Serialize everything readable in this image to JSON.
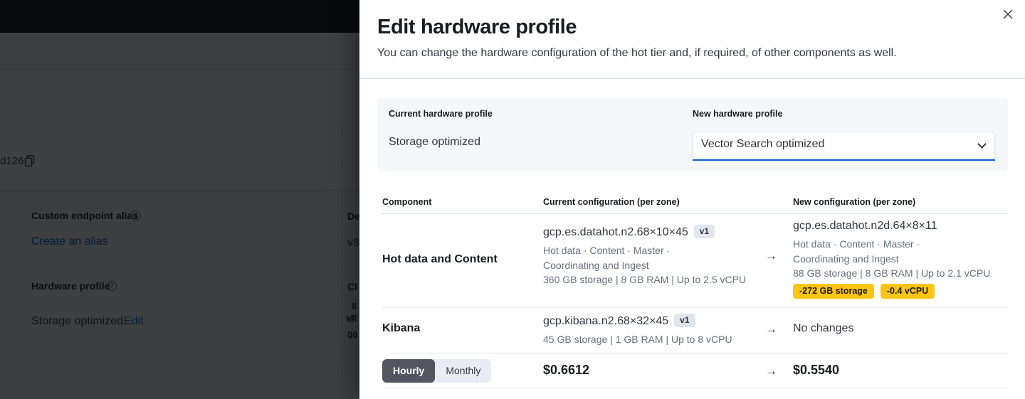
{
  "colors": {
    "accent_blue": "#0b64dd",
    "warning_yellow": "#fec514",
    "toggle_dark": "#53565f"
  },
  "background": {
    "deployment_id_fragment": "d126",
    "custom_endpoint": {
      "label": "Custom endpoint alias",
      "link": "Create an alias"
    },
    "hardware_profile": {
      "label": "Hardware profile",
      "value": "Storage optimized",
      "action": "Edit"
    },
    "right_fragments": [
      "De",
      "v8",
      "Cl",
      "8",
      "WR",
      "Q0"
    ]
  },
  "flyout": {
    "title": "Edit hardware profile",
    "subtitle": "You can change the hardware configuration of the hot tier and, if required, of other components as well.",
    "profile_panel": {
      "current_label": "Current hardware profile",
      "current_value": "Storage optimized",
      "new_label": "New hardware profile",
      "new_value": "Vector Search optimized"
    },
    "table": {
      "headers": [
        "Component",
        "Current configuration (per zone)",
        "New configuration (per zone)"
      ],
      "rows": [
        {
          "component": "Hot data and Content",
          "current": {
            "instance": "gcp.es.datahot.n2.68×10×45",
            "version_badge": "v1",
            "roles_line1": "Hot data · Content · Master ·",
            "roles_line2": "Coordinating and Ingest",
            "specs": "360 GB storage | 8 GB RAM | Up to 2.5 vCPU"
          },
          "new": {
            "instance": "gcp.es.datahot.n2d.64×8×11",
            "roles_line1": "Hot data · Content · Master ·",
            "roles_line2": "Coordinating and Ingest",
            "specs": "88 GB storage | 8 GB RAM | Up to 2.1 vCPU",
            "diff_badges": [
              "-272 GB storage",
              "-0.4 vCPU"
            ]
          }
        },
        {
          "component": "Kibana",
          "current": {
            "instance": "gcp.kibana.n2.68×32×45",
            "version_badge": "v1",
            "specs": "45 GB storage | 1 GB RAM | Up to 8 vCPU"
          },
          "new": {
            "text": "No changes"
          }
        }
      ]
    },
    "pricing": {
      "toggle": [
        "Hourly",
        "Monthly"
      ],
      "selected": "Hourly",
      "current_price": "$0.6612",
      "new_price": "$0.5540"
    }
  }
}
